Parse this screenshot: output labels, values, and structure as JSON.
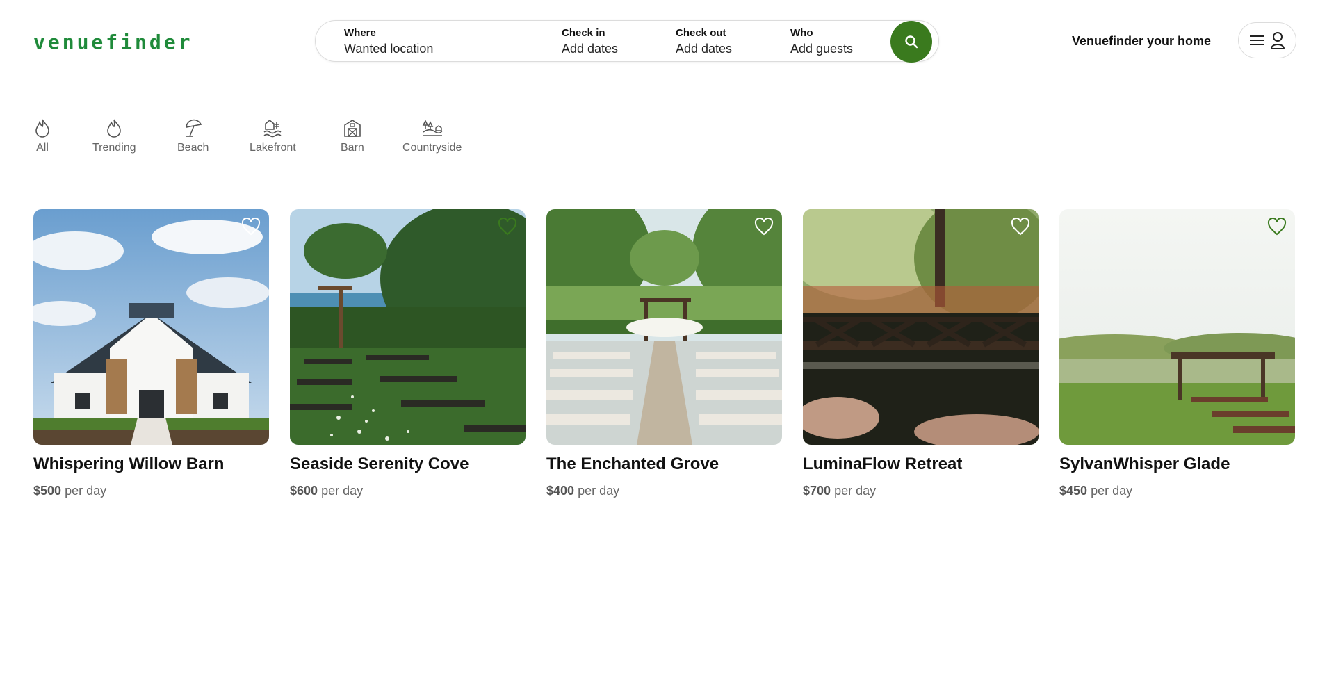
{
  "brand": {
    "logo_text": "venuefinder",
    "accent": "#3a7a1e"
  },
  "search": {
    "where_label": "Where",
    "where_value": "Wanted location",
    "checkin_label": "Check in",
    "checkin_value": "Add dates",
    "checkout_label": "Check out",
    "checkout_value": "Add dates",
    "who_label": "Who",
    "who_value": "Add guests",
    "button_icon": "search-icon"
  },
  "header": {
    "host_link": "Venuefinder your home",
    "menu_icon": "hamburger-icon",
    "user_icon": "user-icon"
  },
  "categories": [
    {
      "label": "All",
      "icon": "flame-icon"
    },
    {
      "label": "Trending",
      "icon": "flame-icon"
    },
    {
      "label": "Beach",
      "icon": "umbrella-icon"
    },
    {
      "label": "Lakefront",
      "icon": "lakefront-icon"
    },
    {
      "label": "Barn",
      "icon": "barn-icon"
    },
    {
      "label": "Countryside",
      "icon": "countryside-icon"
    }
  ],
  "listings": [
    {
      "title": "Whispering Willow Barn",
      "price": "$500",
      "unit": "per day",
      "favorited": false
    },
    {
      "title": "Seaside Serenity Cove",
      "price": "$600",
      "unit": "per day",
      "favorited": true
    },
    {
      "title": "The Enchanted Grove",
      "price": "$400",
      "unit": "per day",
      "favorited": false
    },
    {
      "title": "LuminaFlow Retreat",
      "price": "$700",
      "unit": "per day",
      "favorited": false
    },
    {
      "title": "SylvanWhisper Glade",
      "price": "$450",
      "unit": "per day",
      "favorited": true
    }
  ]
}
